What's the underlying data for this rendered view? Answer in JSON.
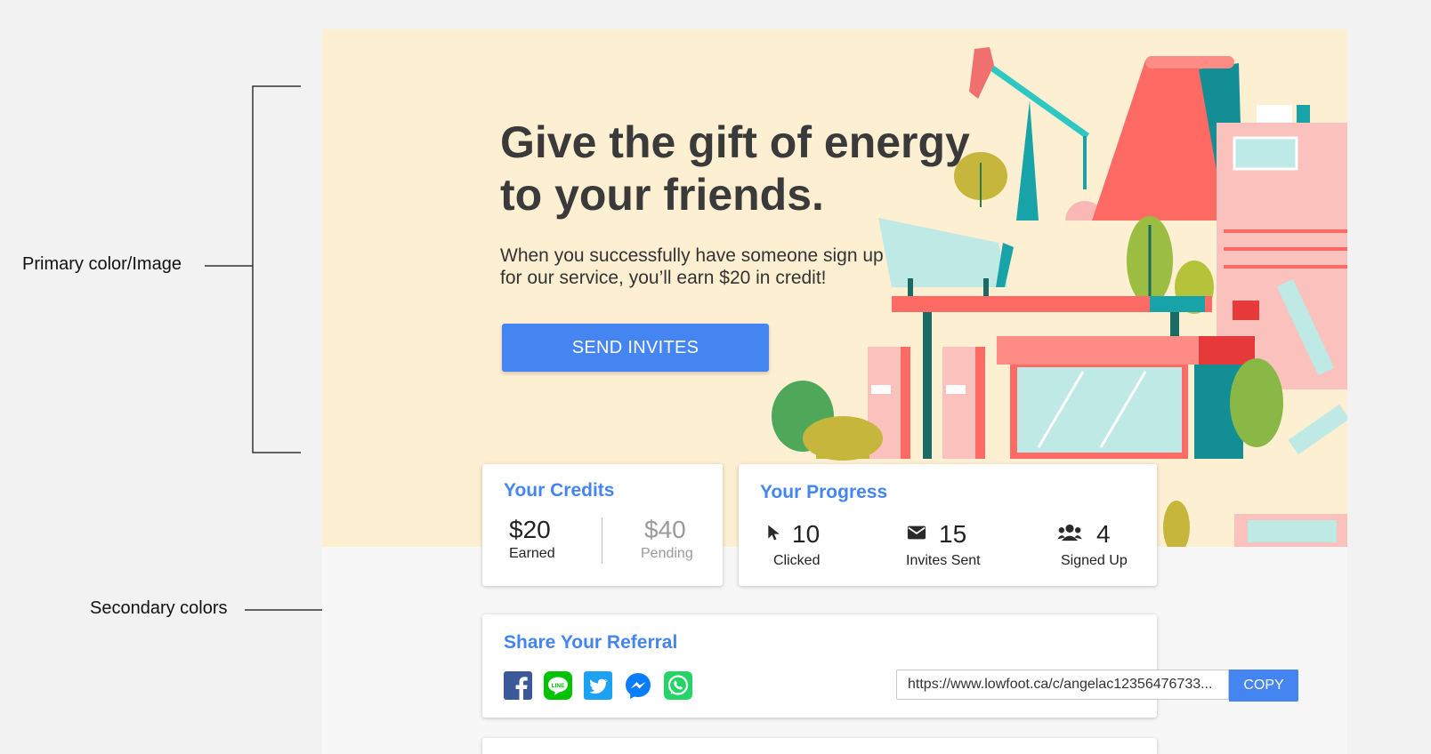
{
  "annotations": {
    "primary": "Primary color/Image",
    "secondary": "Secondary colors"
  },
  "hero": {
    "title": "Give the gift of energy to your friends.",
    "subtitle": "When you successfully have someone sign up for our service, you’ll earn $20 in credit!",
    "cta_label": "SEND INVITES"
  },
  "credits": {
    "title": "Your Credits",
    "earned_value": "$20",
    "earned_label": "Earned",
    "pending_value": "$40",
    "pending_label": "Pending"
  },
  "progress": {
    "title": "Your Progress",
    "items": [
      {
        "icon": "cursor-icon",
        "value": "10",
        "label": "Clicked"
      },
      {
        "icon": "envelope-icon",
        "value": "15",
        "label": "Invites Sent"
      },
      {
        "icon": "users-icon",
        "value": "4",
        "label": "Signed Up"
      }
    ]
  },
  "share": {
    "title": "Share Your Referral",
    "networks": [
      "facebook-icon",
      "line-icon",
      "twitter-icon",
      "messenger-icon",
      "whatsapp-icon"
    ],
    "url": "https://www.lowfoot.ca/c/angelac12356476733...",
    "copy_label": "COPY"
  },
  "colors": {
    "primary_bg": "#fdefd2",
    "accent": "#4485f2",
    "page_bg": "#f2f2f2"
  }
}
